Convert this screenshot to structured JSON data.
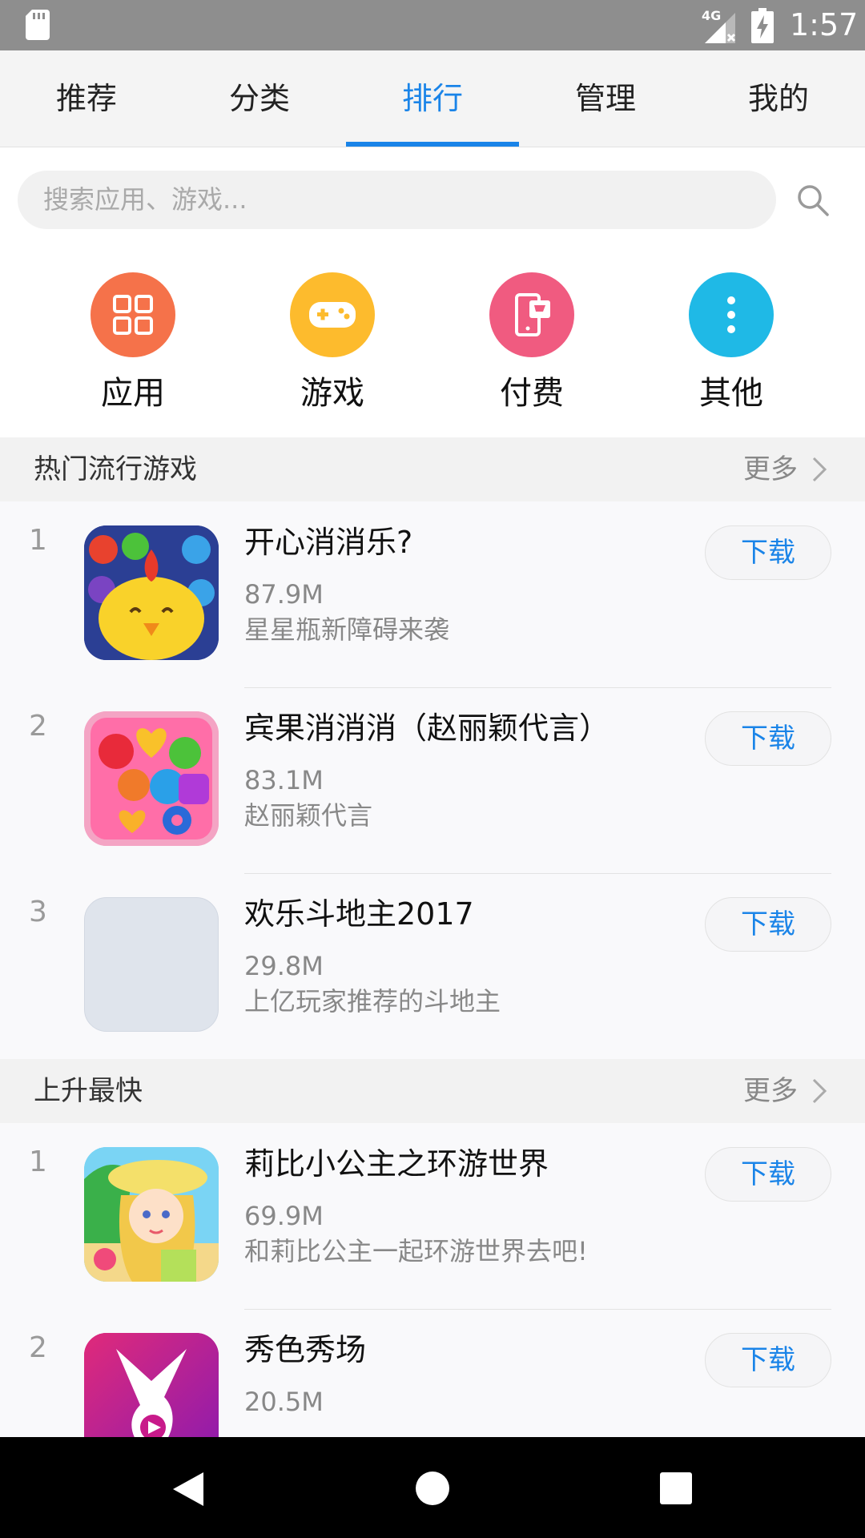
{
  "status_bar": {
    "time": "1:57",
    "network": "4G",
    "icons": [
      "sd-card-icon",
      "signal-icon",
      "battery-charging-icon"
    ]
  },
  "tabs": [
    {
      "label": "推荐",
      "active": false
    },
    {
      "label": "分类",
      "active": false
    },
    {
      "label": "排行",
      "active": true
    },
    {
      "label": "管理",
      "active": false
    },
    {
      "label": "我的",
      "active": false
    }
  ],
  "search": {
    "placeholder": "搜索应用、游戏..."
  },
  "categories": [
    {
      "label": "应用",
      "icon": "apps-grid-icon",
      "color": "#f5724a"
    },
    {
      "label": "游戏",
      "icon": "gamepad-icon",
      "color": "#fdbb2d"
    },
    {
      "label": "付费",
      "icon": "paid-phone-icon",
      "color": "#f05b80"
    },
    {
      "label": "其他",
      "icon": "more-vertical-icon",
      "color": "#1fb9e6"
    }
  ],
  "sections": [
    {
      "title": "热门流行游戏",
      "more": "更多",
      "items": [
        {
          "rank": "1",
          "name": "开心消消乐?",
          "size": "87.9M",
          "desc": "星星瓶新障碍来袭",
          "button": "下载"
        },
        {
          "rank": "2",
          "name": "宾果消消消（赵丽颖代言）",
          "size": "83.1M",
          "desc": "赵丽颖代言",
          "button": "下载"
        },
        {
          "rank": "3",
          "name": "欢乐斗地主2017",
          "size": "29.8M",
          "desc": "上亿玩家推荐的斗地主",
          "button": "下载"
        }
      ]
    },
    {
      "title": "上升最快",
      "more": "更多",
      "items": [
        {
          "rank": "1",
          "name": "莉比小公主之环游世界",
          "size": "69.9M",
          "desc": "和莉比公主一起环游世界去吧!",
          "button": "下载"
        },
        {
          "rank": "2",
          "name": "秀色秀场",
          "size": "20.5M",
          "desc": "",
          "button": "下载"
        }
      ]
    }
  ],
  "nav_bar": {
    "icons": [
      "back-icon",
      "home-icon",
      "recents-icon"
    ]
  },
  "colors": {
    "accent": "#1a84e8",
    "status_bar": "#8e8e8e"
  }
}
